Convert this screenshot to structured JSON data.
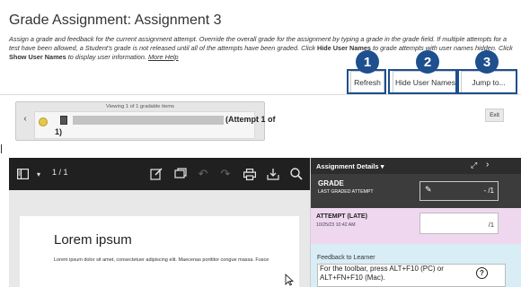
{
  "page": {
    "title": "Grade Assignment: Assignment 3",
    "instructions": {
      "part1": "Assign a grade and feedback for the current assignment attempt. Override the overall grade for the assignment by typing a grade in the grade field. If multiple attempts for a test have been allowed, a Student's grade is not released until all of the attempts have been graded. Click ",
      "bold1": "Hide User Names",
      "part2": " to grade attempts with user names hidden. Click ",
      "bold2": "Show User Names",
      "part3": " to display user information. ",
      "more_help": "More Help"
    }
  },
  "toolbar": {
    "refresh_label": "Refresh",
    "hide_user_names_label": "Hide User Names",
    "jump_to_label": "Jump to..."
  },
  "callouts": [
    "1",
    "2",
    "3"
  ],
  "callout_color": "#1e4f8e",
  "navigator": {
    "count_text": "Viewing 1 of 1 gradable items",
    "attempt_text": "(Attempt 1 of",
    "attempt_text_cont": "1)",
    "prev_icon": "chevron-left-icon",
    "next_icon": "chevron-right-icon"
  },
  "exit_label": "Exit",
  "viewer": {
    "page_counter": "1 / 1",
    "document_heading": "Lorem ipsum",
    "document_body": "Lorem ipsum dolor sit amet, consectetuer adipiscing elit. Maecenas porttitor congue massa. Fusce",
    "icons": [
      "sidebar-icon",
      "chevron-down-icon",
      "edit-icon",
      "comment-icon",
      "undo-icon",
      "redo-icon",
      "print-icon",
      "download-icon",
      "search-icon"
    ]
  },
  "panel": {
    "title": "Assignment Details",
    "grade_label": "GRADE",
    "grade_sub": "LAST GRADED ATTEMPT",
    "grade_value": "- /1",
    "attempt_title": "ATTEMPT (LATE)",
    "attempt_date": "10/25/23 10:42 AM",
    "attempt_score": "/1",
    "feedback_label": "Feedback to Learner",
    "feedback_hint": "For the toolbar, press ALT+F10 (PC) or ALT+FN+F10 (Mac).",
    "help_glyph": "?",
    "colors": {
      "grade_bg": "#3c3c3c",
      "attempt_bg": "#efd8ef",
      "feedback_bg": "#d9edf6"
    }
  }
}
